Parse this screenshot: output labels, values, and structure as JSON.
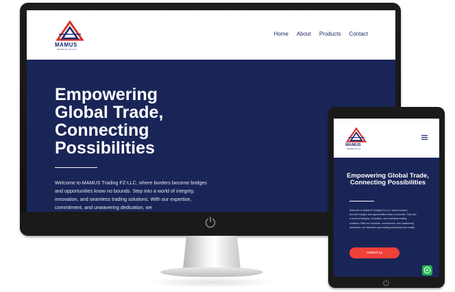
{
  "brand": {
    "name": "MAMUS",
    "subtitle": "TRADING FZ-LLC",
    "colors": {
      "navy": "#1a2557",
      "logo_red": "#d9322c",
      "logo_blue": "#1a2a6c",
      "cta_red": "#f0403a",
      "whatsapp_green": "#1fb350"
    }
  },
  "nav": {
    "items": [
      "Home",
      "About",
      "Products",
      "Contact"
    ]
  },
  "hero": {
    "desktop_title": "Empowering Global Trade, Connecting Possibilities",
    "desktop_body": "Welcome to MAMUS Trading FZ-LLC, where borders become bridges and opportunities know no bounds. Step into a world of integrity, innovation, and seamless trading solutions. With our expertise, commitment, and unwavering dedication, we",
    "mobile_title": "Empowering Global Trade, Connecting Possibilities",
    "mobile_body": "Welcome to MAMUS Trading FZ-LLC, where borders become bridges and opportunities know no bounds. Step into a world of integrity, innovation, and seamless trading solutions. With our expertise, commitment, and unwavering dedication, we transform your trading aspirations into reality.",
    "cta_label": "contact us"
  },
  "icons": {
    "power": "power-icon",
    "menu": "hamburger-menu-icon",
    "whatsapp": "whatsapp-icon",
    "home": "home-button-icon"
  }
}
